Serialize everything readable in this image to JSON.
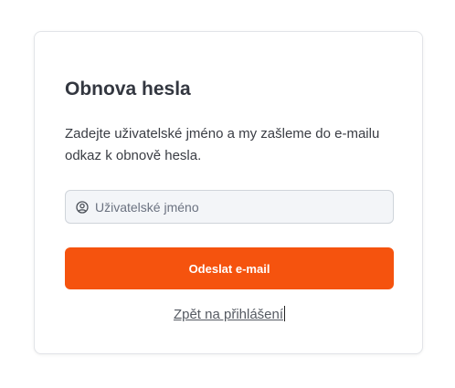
{
  "form": {
    "title": "Obnova hesla",
    "description": "Zadejte uživatelské jméno a my zašleme do e-mailu odkaz k obnově hesla.",
    "username": {
      "placeholder": "Uživatelské jméno",
      "value": "",
      "icon": "user-circle-icon"
    },
    "submit_label": "Odeslat e-mail",
    "back_link_label": "Zpět na přihlášení"
  },
  "colors": {
    "accent": "#f5530e",
    "input_background": "#f3f5f8",
    "title_text": "#333740"
  }
}
